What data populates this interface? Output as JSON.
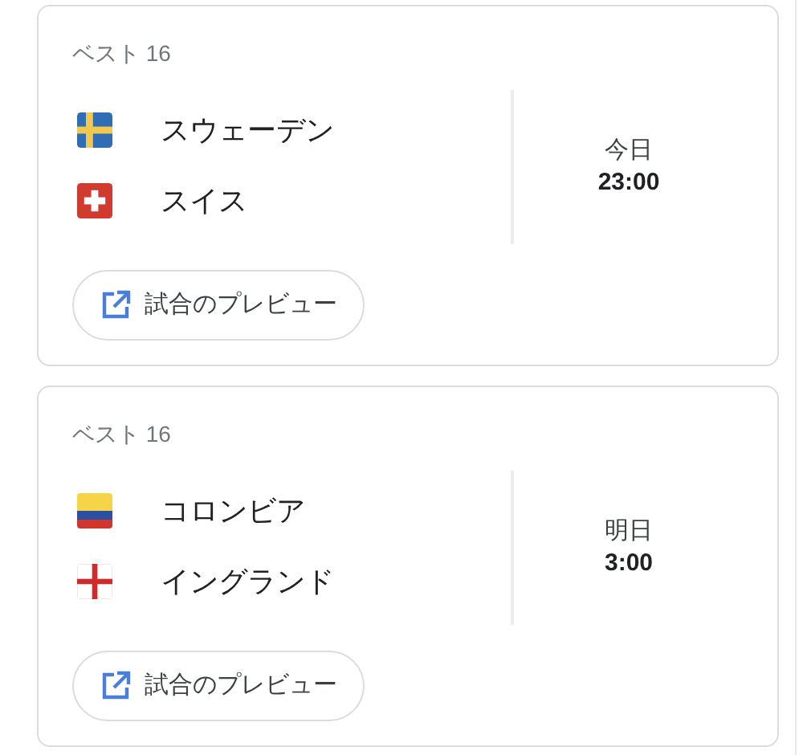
{
  "matches": [
    {
      "stage": "ベスト 16",
      "teams": [
        {
          "name": "スウェーデン",
          "kind": "sweden"
        },
        {
          "name": "スイス",
          "kind": "switzerland"
        }
      ],
      "day": "今日",
      "time": "23:00",
      "button": "試合のプレビュー"
    },
    {
      "stage": "ベスト 16",
      "teams": [
        {
          "name": "コロンビア",
          "kind": "colombia"
        },
        {
          "name": "イングランド",
          "kind": "england"
        }
      ],
      "day": "明日",
      "time": "3:00",
      "button": "試合のプレビュー"
    }
  ]
}
